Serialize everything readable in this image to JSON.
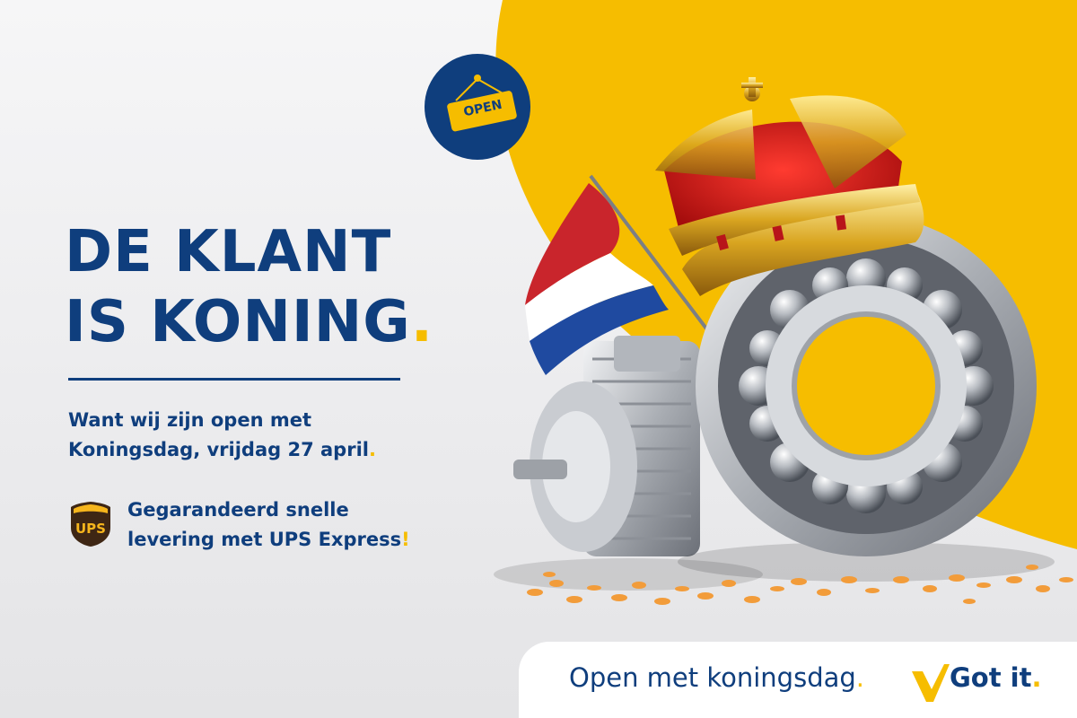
{
  "headline": {
    "line1": "DE KLANT",
    "line2": "IS KONING",
    "dot": "."
  },
  "intro": {
    "line1": "Want wij zijn open met",
    "line2": "Koningsdag, vrijdag 27 april",
    "dot": "."
  },
  "delivery": {
    "line1": "Gegarandeerd snelle",
    "line2": "levering met UPS Express",
    "mark": "!"
  },
  "ups_logo_text": "UPS",
  "badge": {
    "text": "OPEN"
  },
  "footer": {
    "tagline": "Open met koningsdag",
    "tagline_dot": ".",
    "brand": "Got it",
    "brand_dot": "."
  },
  "colors": {
    "navy": "#0f3e7d",
    "yellow": "#f6bd00",
    "background": "#efeff1"
  },
  "icons": [
    "open-sign-icon",
    "ups-logo-icon",
    "checkmark-logo-icon"
  ]
}
